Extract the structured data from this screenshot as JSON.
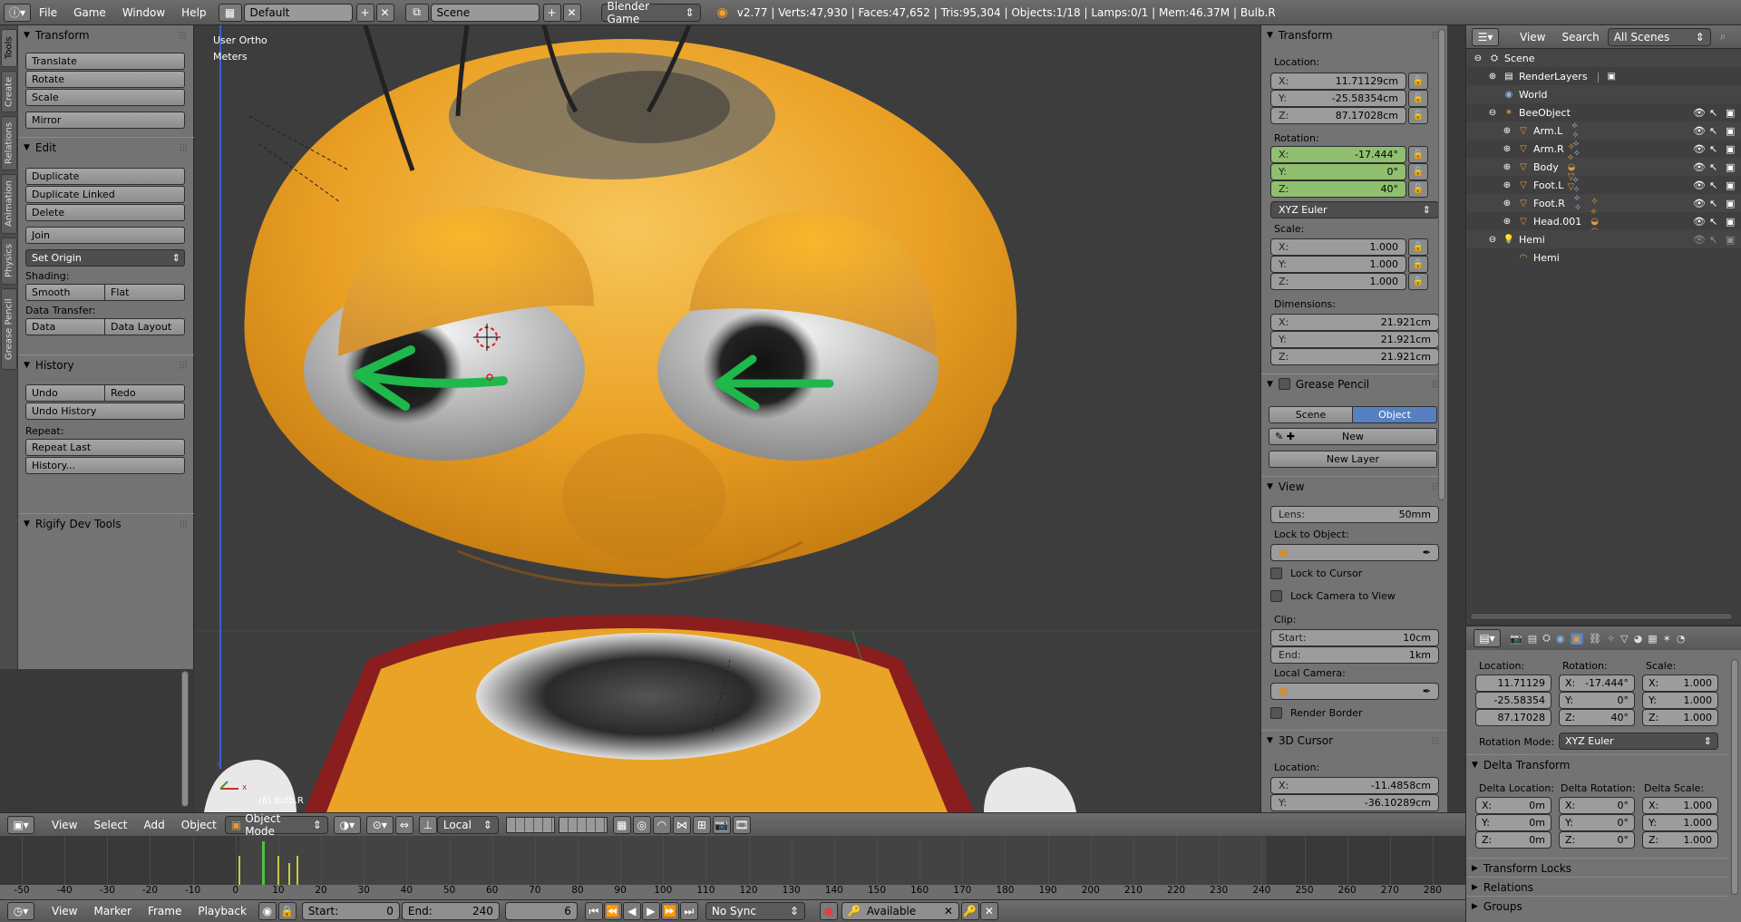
{
  "topbar": {
    "menus": [
      "File",
      "Game",
      "Window",
      "Help"
    ],
    "layout": "Default",
    "scene": "Scene",
    "engine": "Blender Game",
    "stats": "v2.77 | Verts:47,930 | Faces:47,652 | Tris:95,304 | Objects:1/18 | Lamps:0/1 | Mem:46.37M | Bulb.R"
  },
  "tabs": [
    "Tools",
    "Create",
    "Relations",
    "Animation",
    "Physics",
    "Grease Pencil"
  ],
  "toolshelf": {
    "transform_title": "Transform",
    "translate": "Translate",
    "rotate": "Rotate",
    "scale": "Scale",
    "mirror": "Mirror",
    "edit_title": "Edit",
    "duplicate": "Duplicate",
    "duplicate_linked": "Duplicate Linked",
    "delete": "Delete",
    "join": "Join",
    "set_origin": "Set Origin",
    "shading_label": "Shading:",
    "smooth": "Smooth",
    "flat": "Flat",
    "data_transfer_label": "Data Transfer:",
    "data": "Data",
    "data_layout": "Data Layout",
    "history_title": "History",
    "undo": "Undo",
    "redo": "Redo",
    "undo_history": "Undo History",
    "repeat_label": "Repeat:",
    "repeat_last": "Repeat Last",
    "history_btn": "History...",
    "rigify_title": "Rigify Dev Tools"
  },
  "viewport": {
    "view_name": "User Ortho",
    "units": "Meters",
    "object_label": "(6) Bulb.R"
  },
  "npanel": {
    "transform_title": "Transform",
    "location_label": "Location:",
    "loc": [
      {
        "k": "X:",
        "v": "11.71129cm"
      },
      {
        "k": "Y:",
        "v": "-25.58354cm"
      },
      {
        "k": "Z:",
        "v": "87.17028cm"
      }
    ],
    "rotation_label": "Rotation:",
    "rot": [
      {
        "k": "X:",
        "v": "-17.444°"
      },
      {
        "k": "Y:",
        "v": "0°"
      },
      {
        "k": "Z:",
        "v": "40°"
      }
    ],
    "rotation_mode": "XYZ Euler",
    "scale_label": "Scale:",
    "scl": [
      {
        "k": "X:",
        "v": "1.000"
      },
      {
        "k": "Y:",
        "v": "1.000"
      },
      {
        "k": "Z:",
        "v": "1.000"
      }
    ],
    "dimensions_label": "Dimensions:",
    "dim": [
      {
        "k": "X:",
        "v": "21.921cm"
      },
      {
        "k": "Y:",
        "v": "21.921cm"
      },
      {
        "k": "Z:",
        "v": "21.921cm"
      }
    ],
    "grease_title": "Grease Pencil",
    "gp_scene": "Scene",
    "gp_object": "Object",
    "gp_new": "New",
    "gp_new_layer": "New Layer",
    "view_title": "View",
    "lens_label": "Lens:",
    "lens_value": "50mm",
    "lock_object_label": "Lock to Object:",
    "lock_cursor": "Lock to Cursor",
    "lock_camera": "Lock Camera to View",
    "clip_label": "Clip:",
    "clip_start_label": "Start:",
    "clip_start": "10cm",
    "clip_end_label": "End:",
    "clip_end": "1km",
    "local_camera_label": "Local Camera:",
    "render_border": "Render Border",
    "cursor_title": "3D Cursor",
    "cursor_location_label": "Location:",
    "cursor": [
      {
        "k": "X:",
        "v": "-11.4858cm"
      },
      {
        "k": "Y:",
        "v": "-36.10289cm"
      }
    ]
  },
  "outliner": {
    "view_menu": "View",
    "search_menu": "Search",
    "filter": "All Scenes",
    "items": [
      "Scene",
      "RenderLayers",
      "World",
      "BeeObject",
      "Arm.L",
      "Arm.R",
      "Body",
      "Foot.L",
      "Foot.R",
      "Head.001",
      "Hemi",
      "Hemi"
    ]
  },
  "properties": {
    "location_label": "Location:",
    "rotation_label": "Rotation:",
    "scale_label": "Scale:",
    "loc": [
      "11.71129",
      "-25.58354",
      "87.17028"
    ],
    "rot": [
      {
        "k": "X:",
        "v": "-17.444°"
      },
      {
        "k": "Y:",
        "v": "0°"
      },
      {
        "k": "Z:",
        "v": "40°"
      }
    ],
    "scl": [
      {
        "k": "X:",
        "v": "1.000"
      },
      {
        "k": "Y:",
        "v": "1.000"
      },
      {
        "k": "Z:",
        "v": "1.000"
      }
    ],
    "rotation_mode_label": "Rotation Mode:",
    "rotation_mode": "XYZ Euler",
    "delta_title": "Delta Transform",
    "delta_location_label": "Delta Location:",
    "delta_rotation_label": "Delta Rotation:",
    "delta_scale_label": "Delta Scale:",
    "dloc": [
      {
        "k": "X:",
        "v": "0m"
      },
      {
        "k": "Y:",
        "v": "0m"
      },
      {
        "k": "Z:",
        "v": "0m"
      }
    ],
    "drot": [
      {
        "k": "X:",
        "v": "0°"
      },
      {
        "k": "Y:",
        "v": "0°"
      },
      {
        "k": "Z:",
        "v": "0°"
      }
    ],
    "dscl": [
      {
        "k": "X:",
        "v": "1.000"
      },
      {
        "k": "Y:",
        "v": "1.000"
      },
      {
        "k": "Z:",
        "v": "1.000"
      }
    ],
    "transform_locks": "Transform Locks",
    "relations": "Relations",
    "groups": "Groups"
  },
  "viewheader": {
    "view": "View",
    "select": "Select",
    "add": "Add",
    "object": "Object",
    "mode": "Object Mode",
    "pivot": "Local"
  },
  "timeline": {
    "ticks": [
      "-50",
      "-40",
      "-30",
      "-20",
      "-10",
      "0",
      "10",
      "20",
      "30",
      "40",
      "50",
      "60",
      "70",
      "80",
      "90",
      "100",
      "110",
      "120",
      "130",
      "140",
      "150",
      "160",
      "170",
      "180",
      "190",
      "200",
      "210",
      "220",
      "230",
      "240",
      "250",
      "260",
      "270",
      "280"
    ],
    "view": "View",
    "marker": "Marker",
    "frame": "Frame",
    "playback": "Playback",
    "start_label": "Start:",
    "start": "0",
    "end_label": "End:",
    "end": "240",
    "current": "6",
    "sync": "No Sync",
    "keying": "Available"
  }
}
